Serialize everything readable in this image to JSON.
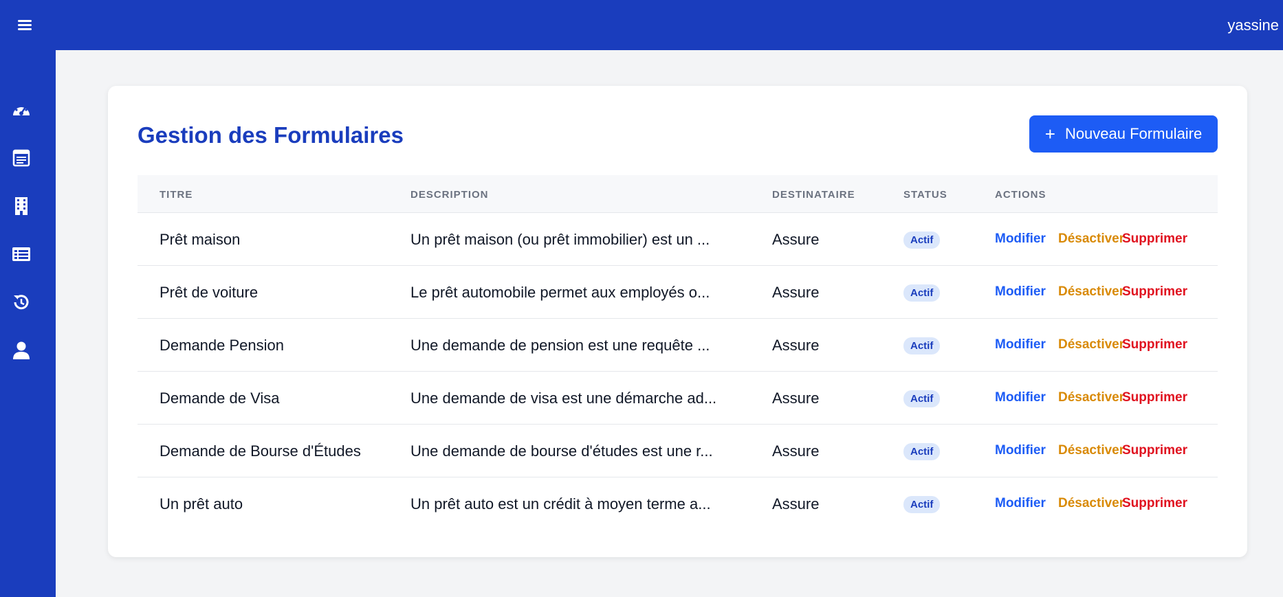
{
  "topbar": {
    "username": "yassine"
  },
  "sidebar": {
    "items": [
      {
        "icon": "dashboard-icon"
      },
      {
        "icon": "forms-icon"
      },
      {
        "icon": "building-icon"
      },
      {
        "icon": "list-icon"
      },
      {
        "icon": "history-icon"
      },
      {
        "icon": "user-icon"
      }
    ]
  },
  "main": {
    "title": "Gestion des Formulaires",
    "new_button": {
      "icon": "+",
      "label": "Nouveau Formulaire"
    },
    "table": {
      "headers": {
        "title": "TITRE",
        "description": "DESCRIPTION",
        "recipient": "DESTINATAIRE",
        "status": "STATUS",
        "actions": "ACTIONS"
      },
      "action_labels": {
        "edit": "Modifier",
        "deactivate": "Désactiver",
        "delete": "Supprimer"
      },
      "rows": [
        {
          "title": "Prêt maison",
          "description": "Un prêt maison (ou prêt immobilier) est un ...",
          "recipient": "Assure",
          "status": "Actif"
        },
        {
          "title": "Prêt de voiture",
          "description": "Le prêt automobile permet aux employés o...",
          "recipient": "Assure",
          "status": "Actif"
        },
        {
          "title": "Demande Pension",
          "description": "Une demande de pension est une requête ...",
          "recipient": "Assure",
          "status": "Actif"
        },
        {
          "title": "Demande de Visa",
          "description": "Une demande de visa est une démarche ad...",
          "recipient": "Assure",
          "status": "Actif"
        },
        {
          "title": "Demande de Bourse d'Études",
          "description": "Une demande de bourse d'études est une r...",
          "recipient": "Assure",
          "status": "Actif"
        },
        {
          "title": "Un prêt auto",
          "description": "Un prêt auto est un crédit à moyen terme a...",
          "recipient": "Assure",
          "status": "Actif"
        }
      ]
    }
  },
  "colors": {
    "primary": "#1a3dbd",
    "button": "#1d5cf5",
    "edit": "#1d5cf5",
    "deactivate": "#d98a06",
    "delete": "#e0121f"
  }
}
